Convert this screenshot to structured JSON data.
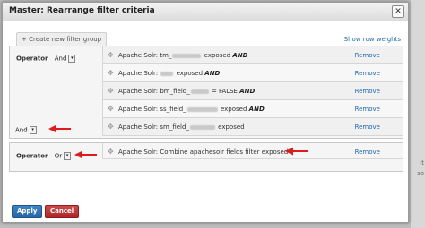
{
  "dialog": {
    "title": "Master: Rearrange filter criteria",
    "close_glyph": "✕"
  },
  "toolbar": {
    "create_group_label": "+ Create new filter group",
    "show_row_weights_label": "Show row weights"
  },
  "groups": [
    {
      "operator_label": "Operator",
      "operator_value": "And",
      "filters": [
        {
          "prefix": "Apache Solr: tm_",
          "suffix": " exposed",
          "connector": "AND",
          "remove_label": "Remove"
        },
        {
          "prefix": "Apache Solr: ",
          "suffix": " exposed",
          "connector": "AND",
          "remove_label": "Remove"
        },
        {
          "prefix": "Apache Solr: bm_field_",
          "suffix": " = FALSE",
          "connector": "AND",
          "remove_label": "Remove"
        },
        {
          "prefix": "Apache Solr: ss_field_",
          "suffix": " exposed",
          "connector": "AND",
          "remove_label": "Remove"
        },
        {
          "prefix": "Apache Solr: sm_field_",
          "suffix": " exposed",
          "connector": "",
          "remove_label": "Remove"
        }
      ]
    },
    {
      "operator_label": "Operator",
      "operator_value": "Or",
      "filters": [
        {
          "prefix": "Apache Solr: Combine apachesolr fields filter exposed",
          "suffix": "",
          "connector": "",
          "remove_label": "Remove"
        }
      ]
    }
  ],
  "group_connector_value": "And",
  "select_arrow_glyph": "▾",
  "drag_handle_glyph": "✥",
  "buttons": {
    "apply_label": "Apply",
    "cancel_label": "Cancel"
  },
  "background_fragments": [
    "lt",
    "so"
  ],
  "colors": {
    "link": "#1f66b5",
    "apply": "#2466a6",
    "cancel": "#ae2424",
    "annotation_arrow": "#e01b1b"
  }
}
